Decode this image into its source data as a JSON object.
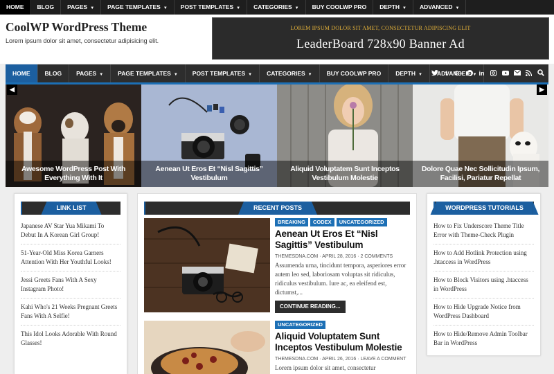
{
  "topbar": {
    "items": [
      {
        "label": "HOME",
        "dropdown": false
      },
      {
        "label": "BLOG",
        "dropdown": false
      },
      {
        "label": "PAGES",
        "dropdown": true
      },
      {
        "label": "PAGE TEMPLATES",
        "dropdown": true
      },
      {
        "label": "POST TEMPLATES",
        "dropdown": true
      },
      {
        "label": "CATEGORIES",
        "dropdown": true
      },
      {
        "label": "BUY COOLWP PRO",
        "dropdown": false
      },
      {
        "label": "DEPTH",
        "dropdown": true
      },
      {
        "label": "ADVANCED",
        "dropdown": true
      }
    ]
  },
  "header": {
    "title": "CoolWP WordPress Theme",
    "tagline": "Lorem ipsum dolor sit amet, consectetur adipisicing elit.",
    "banner_line1": "LOREM IPSUM DOLOR SIT AMET, CONSECTETUR ADIPISCING ELIT",
    "banner_line2": "LeaderBoard 728x90 Banner Ad"
  },
  "mainnav": {
    "items": [
      {
        "label": "HOME",
        "dropdown": false
      },
      {
        "label": "BLOG",
        "dropdown": false
      },
      {
        "label": "PAGES",
        "dropdown": true
      },
      {
        "label": "PAGE TEMPLATES",
        "dropdown": true
      },
      {
        "label": "POST TEMPLATES",
        "dropdown": true
      },
      {
        "label": "CATEGORIES",
        "dropdown": true
      },
      {
        "label": "BUY COOLWP PRO",
        "dropdown": false
      },
      {
        "label": "DEPTH",
        "dropdown": true
      },
      {
        "label": "ADVANCED",
        "dropdown": true
      }
    ],
    "social_icons": [
      "twitter-icon",
      "facebook-icon",
      "google-plus-icon",
      "pinterest-icon",
      "linkedin-icon",
      "instagram-icon",
      "youtube-icon",
      "email-icon",
      "rss-icon",
      "search-icon"
    ]
  },
  "slider": {
    "slides": [
      {
        "caption": "Awesome WordPress Post With Everything With It",
        "image": "three-dogs"
      },
      {
        "caption": "Aenean Ut Eros Et “Nisl Sagittis” Vestibulum",
        "image": "camera-flatlay"
      },
      {
        "caption": "Aliquid Voluptatem Sunt Inceptos Vestibulum Molestie",
        "image": "woman-with-flower"
      },
      {
        "caption": "Dolore Quae Nec Sollicitudin Ipsum, Facilisi, Pariatur Repellat",
        "image": "man-with-dog"
      }
    ]
  },
  "sidebar_left": {
    "title": "LINK LIST",
    "items": [
      "Japanese AV Star Yua Mikami To Debut In A Korean Girl Group!",
      "51-Year-Old Miss Korea Garners Attention With Her Youthful Looks!",
      "Jessi Greets Fans With A Sexy Instagram Photo!",
      "Kahi Who's 21 Weeks Pregnant Greets Fans With A Selfie!",
      "This Idol Looks Adorable With Round Glasses!"
    ]
  },
  "center": {
    "title": "RECENT POSTS",
    "posts": [
      {
        "tags": [
          "BREAKING",
          "CODEX",
          "UNCATEGORIZED"
        ],
        "title": "Aenean Ut Eros Et “Nisl Sagittis” Vestibulum",
        "author": "THEMESDNA.COM",
        "date": "APRIL 28, 2016",
        "comments": "2 COMMENTS",
        "excerpt": "Assumenda urna, tincidunt tempora, asperiores error autem leo sed, laboriosam voluptas sit ridiculus, ridiculus vestibulum. Iure ac, ea eleifend est, dictumst,...",
        "read_more": "CONTINUE READING..."
      },
      {
        "tags": [
          "UNCATEGORIZED"
        ],
        "title": "Aliquid Voluptatem Sunt Inceptos Vestibulum Molestie",
        "author": "THEMESDNA.COM",
        "date": "APRIL 26, 2016",
        "comments": "LEAVE A COMMENT",
        "excerpt": "Lorem ipsum dolor sit amet, consectetur",
        "read_more": ""
      }
    ]
  },
  "sidebar_right": {
    "title": "WORDPRESS TUTORIALS",
    "items": [
      "How to Fix Underscore Theme Title Error with Theme-Check Plugin",
      "How to Add Hotlink Protection using .htaccess in WordPress",
      "How to Block Visitors using .htaccess in WordPress",
      "How to Hide Upgrade Notice from WordPress Dashboard",
      "How to Hide/Remove Admin Toolbar Bar in WordPress"
    ]
  },
  "colors": {
    "accent": "#1c5fa0",
    "dark": "#2d2d2d",
    "banner_text": "#e7b43a"
  }
}
